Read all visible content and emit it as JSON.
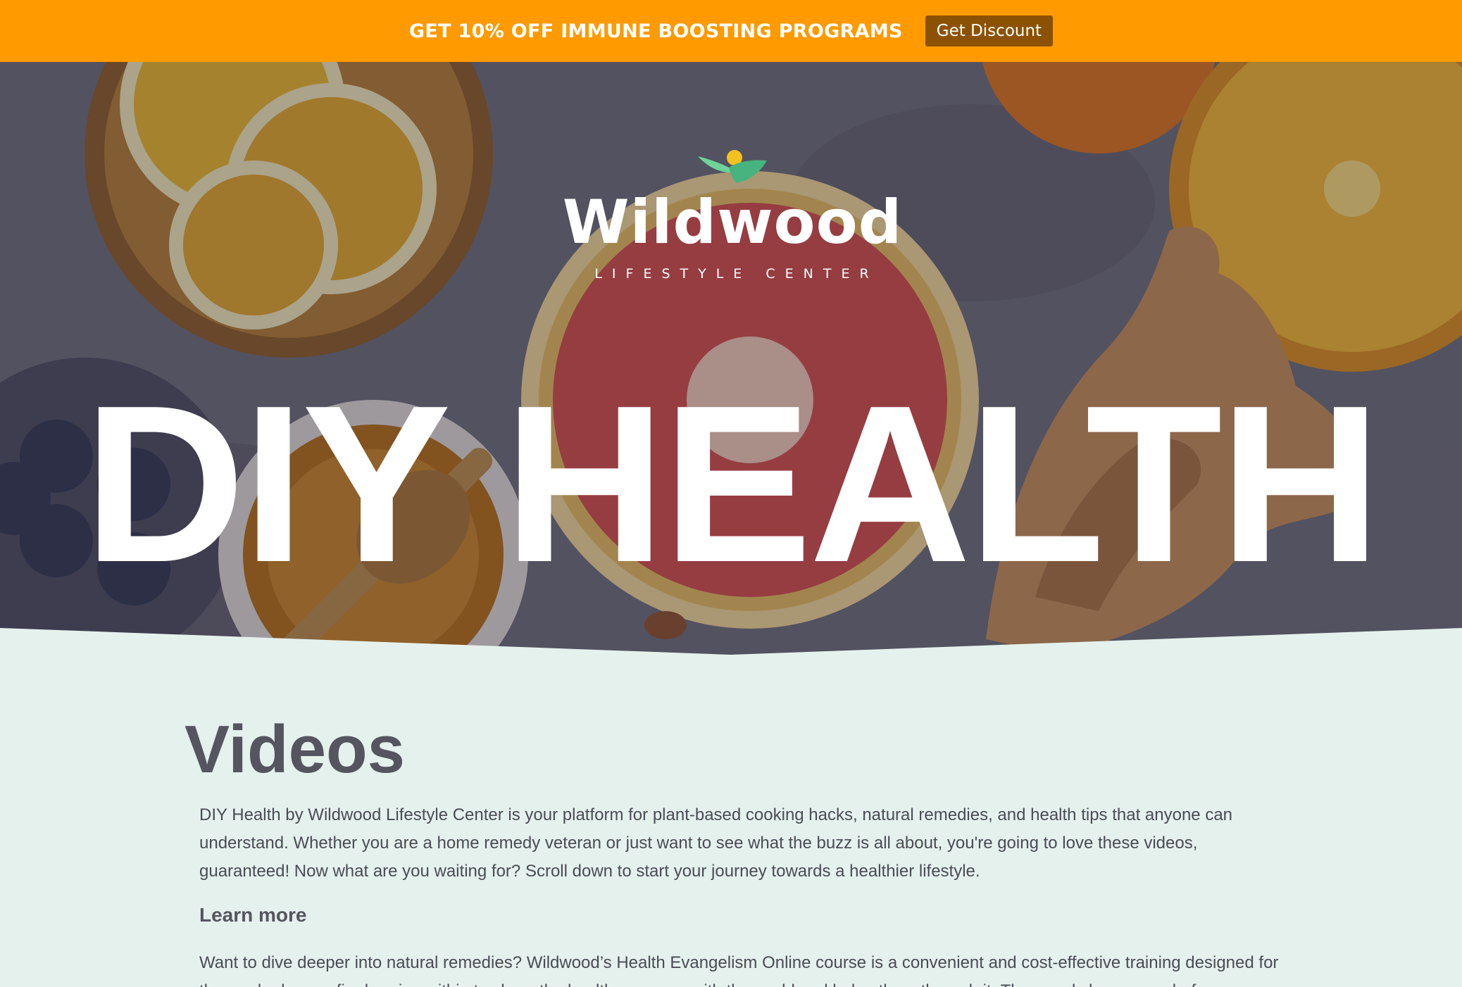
{
  "promo": {
    "text": "GET 10% OFF IMMUNE BOOSTING PROGRAMS",
    "button_label": "Get Discount"
  },
  "hero": {
    "logo": {
      "icon": "leaf-sun-logo-icon",
      "name": "Wildwood",
      "tagline": "LIFESTYLE CENTER"
    },
    "title": "DIY HEALTH"
  },
  "content": {
    "title": "Videos",
    "intro": "DIY Health by Wildwood Lifestyle Center is your platform for plant-based cooking hacks, natural remedies, and health tips that anyone can understand. Whether you are a home remedy veteran or just want to see what the buzz is all about, you're going to love these videos, guaranteed! Now what are you waiting for? Scroll down to start your journey towards a healthier lifestyle.",
    "learn_more_heading": "Learn more",
    "learn_more_text": "Want to dive deeper into natural remedies? Wildwood’s Health Evangelism Online course is a convenient and cost-effective training designed for those who have a fire burning within to share the health message with the world and help others through it. Thousands have gone before"
  },
  "colors": {
    "promo_bar": "#ff9a00",
    "promo_button": "#8c5203",
    "content_background": "#e5f1ed",
    "heading_text": "#555560",
    "body_text": "#4b4b55"
  }
}
